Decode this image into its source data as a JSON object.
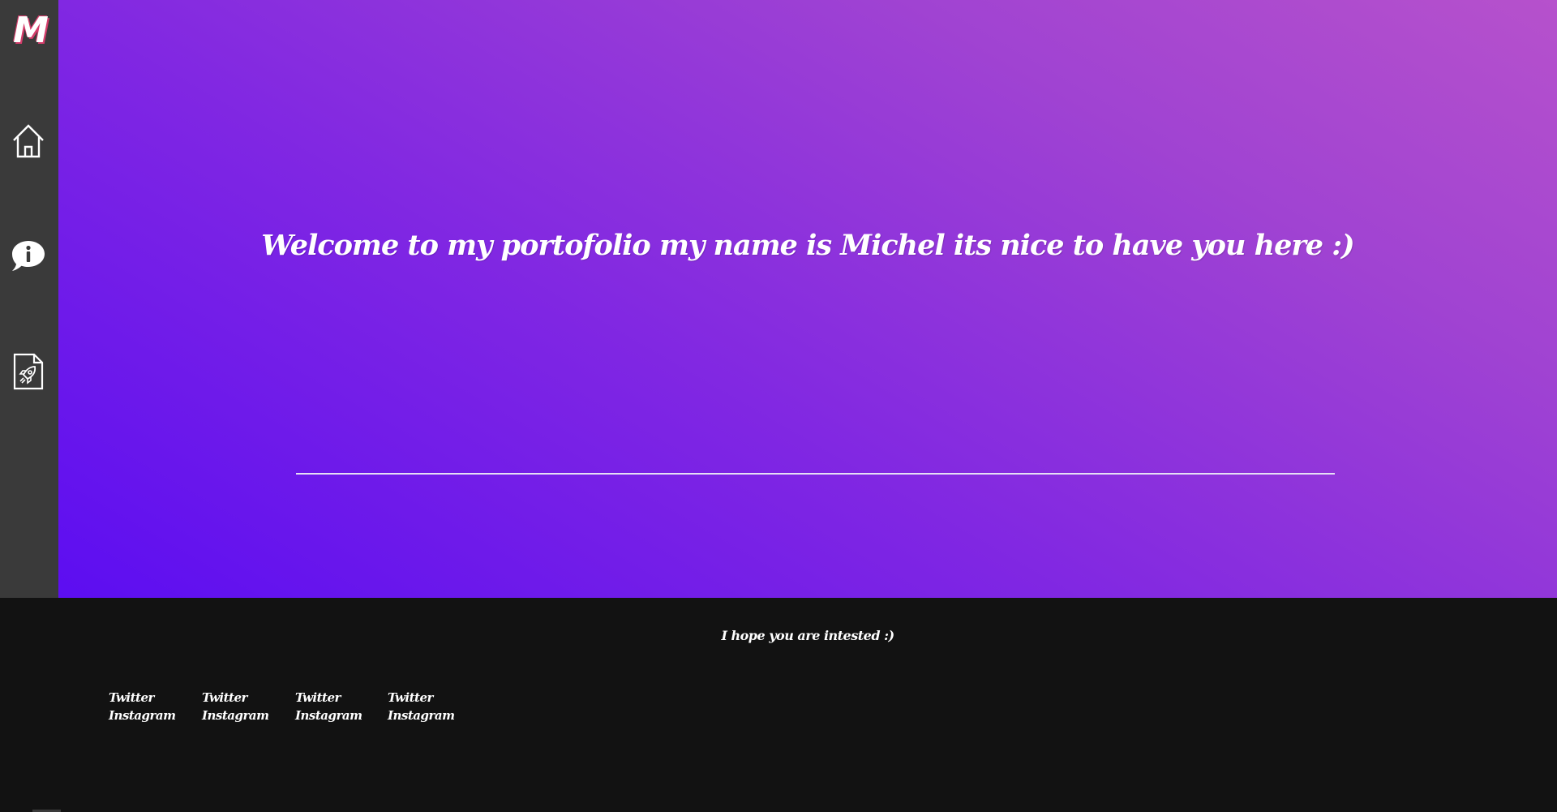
{
  "brand": {
    "logo_text": "M"
  },
  "sidebar": {
    "items": [
      {
        "name": "home",
        "icon": "home-icon"
      },
      {
        "name": "about",
        "icon": "info-bubble-icon"
      },
      {
        "name": "projects",
        "icon": "rocket-document-icon"
      }
    ]
  },
  "hero": {
    "welcome_text": "Welcome to my portofolio my name is Michel its nice to have you here :)"
  },
  "footer": {
    "message": "I hope you are intested :)",
    "social_columns": [
      {
        "twitter": "Twitter",
        "instagram": "Instagram"
      },
      {
        "twitter": "Twitter",
        "instagram": "Instagram"
      },
      {
        "twitter": "Twitter",
        "instagram": "Instagram"
      },
      {
        "twitter": "Twitter",
        "instagram": "Instagram"
      }
    ]
  },
  "colors": {
    "gradient_start": "#5a0cf2",
    "gradient_end": "#b651cc",
    "sidebar_bg": "#3a3a3a",
    "footer_bg": "#121212",
    "logo_accent": "#d43d6b"
  }
}
